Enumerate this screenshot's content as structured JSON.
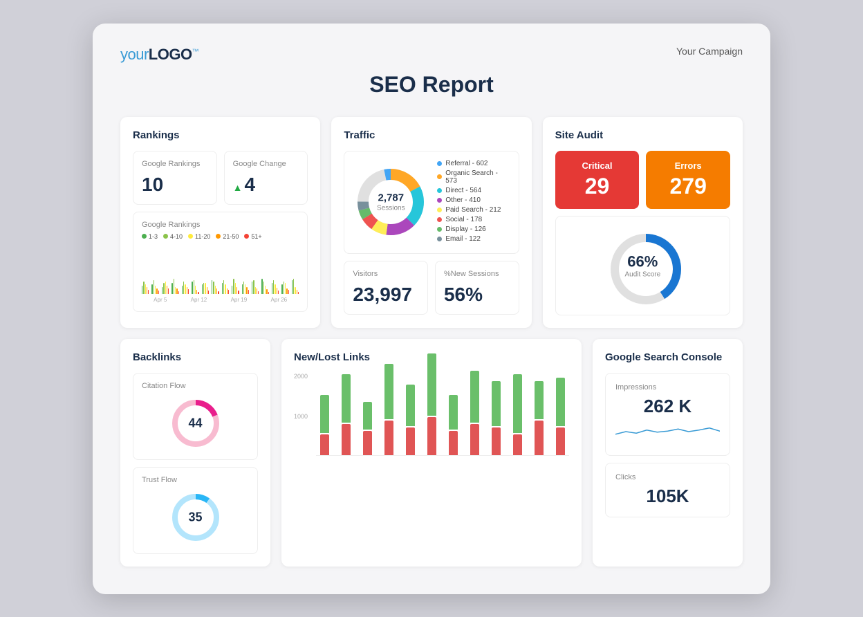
{
  "header": {
    "logo_your": "your",
    "logo_LOGO": "LOGO",
    "logo_tm": "™",
    "campaign": "Your Campaign"
  },
  "title": "SEO Report",
  "rankings": {
    "section_label": "Rankings",
    "google_rankings_label": "Google Rankings",
    "google_rankings_value": "10",
    "google_change_label": "Google Change",
    "google_change_value": "4",
    "chart_label": "Google Rankings",
    "legend": [
      {
        "label": "1-3",
        "color": "#4caf50"
      },
      {
        "label": "4-10",
        "color": "#8bc34a"
      },
      {
        "label": "11-20",
        "color": "#ffeb3b"
      },
      {
        "label": "21-50",
        "color": "#ff9800"
      },
      {
        "label": "51+",
        "color": "#f44336"
      }
    ],
    "x_labels": [
      "Apr 5",
      "Apr 12",
      "Apr 19",
      "Apr 26"
    ]
  },
  "traffic": {
    "section_label": "Traffic",
    "donut_value": "2,787",
    "donut_label": "Sessions",
    "legend": [
      {
        "label": "Referral - 602",
        "color": "#42a5f5"
      },
      {
        "label": "Organic Search - 573",
        "color": "#ffa726"
      },
      {
        "label": "Direct - 564",
        "color": "#26c6da"
      },
      {
        "label": "Other - 410",
        "color": "#ab47bc"
      },
      {
        "label": "Paid Search - 212",
        "color": "#ffee58"
      },
      {
        "label": "Social - 178",
        "color": "#ef5350"
      },
      {
        "label": "Display - 126",
        "color": "#66bb6a"
      },
      {
        "label": "Email - 122",
        "color": "#78909c"
      }
    ],
    "visitors_label": "Visitors",
    "visitors_value": "23,997",
    "new_sessions_label": "%New Sessions",
    "new_sessions_value": "56%"
  },
  "site_audit": {
    "section_label": "Site Audit",
    "critical_label": "Critical",
    "critical_value": "29",
    "errors_label": "Errors",
    "errors_value": "279",
    "score_value": "66%",
    "score_label": "Audit Score",
    "score_percent": 66
  },
  "backlinks": {
    "section_label": "Backlinks",
    "citation_flow_label": "Citation Flow",
    "citation_flow_value": "44",
    "trust_flow_label": "Trust Flow",
    "new_lost_label": "New/Lost Links",
    "y_labels": [
      "2000",
      "1000"
    ],
    "bars": [
      {
        "new": 55,
        "lost": 30
      },
      {
        "new": 70,
        "lost": 45
      },
      {
        "new": 40,
        "lost": 35
      },
      {
        "new": 80,
        "lost": 50
      },
      {
        "new": 60,
        "lost": 40
      },
      {
        "new": 90,
        "lost": 55
      },
      {
        "new": 50,
        "lost": 35
      },
      {
        "new": 75,
        "lost": 45
      },
      {
        "new": 65,
        "lost": 40
      },
      {
        "new": 85,
        "lost": 30
      },
      {
        "new": 55,
        "lost": 50
      },
      {
        "new": 70,
        "lost": 40
      }
    ]
  },
  "gsc": {
    "section_label": "Google Search Console",
    "impressions_label": "Impressions",
    "impressions_value": "262 K",
    "clicks_label": "Clicks",
    "clicks_value": "105K"
  }
}
